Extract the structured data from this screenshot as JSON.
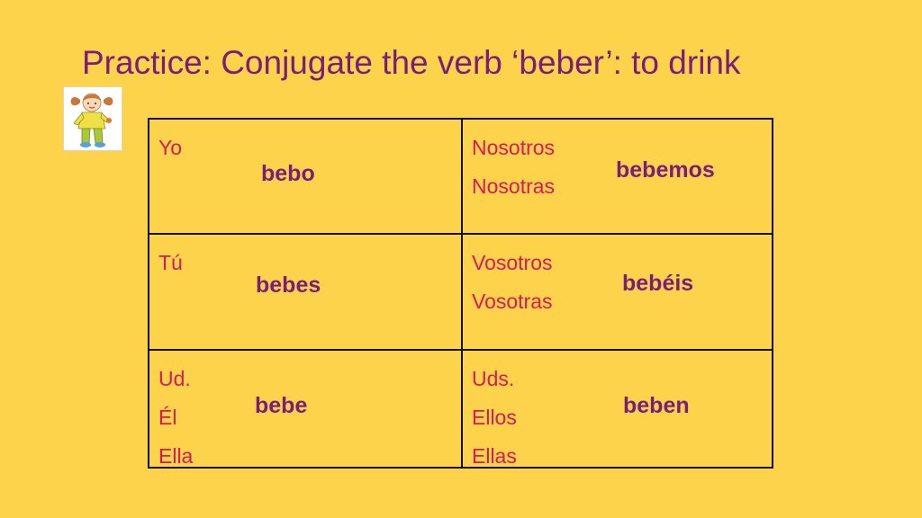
{
  "title": "Practice: Conjugate the verb ‘beber’: to drink",
  "clipart_icon": "girl-cartoon-icon",
  "colors": {
    "background": "#FCD34A",
    "title": "#7A1E7A",
    "pronoun": "#D8195A",
    "answer": "#7A1E7A",
    "border": "#111111"
  },
  "table": {
    "cells": [
      {
        "pronouns": [
          "Yo"
        ],
        "answer": "bebo"
      },
      {
        "pronouns": [
          "Nosotros",
          "Nosotras"
        ],
        "answer": "bebemos"
      },
      {
        "pronouns": [
          "Tú"
        ],
        "answer": "bebes"
      },
      {
        "pronouns": [
          "Vosotros",
          "Vosotras"
        ],
        "answer": "bebéis"
      },
      {
        "pronouns": [
          "Ud.",
          "Él",
          "Ella"
        ],
        "answer": "bebe"
      },
      {
        "pronouns": [
          "Uds.",
          "Ellos",
          "Ellas"
        ],
        "answer": "beben"
      }
    ]
  }
}
